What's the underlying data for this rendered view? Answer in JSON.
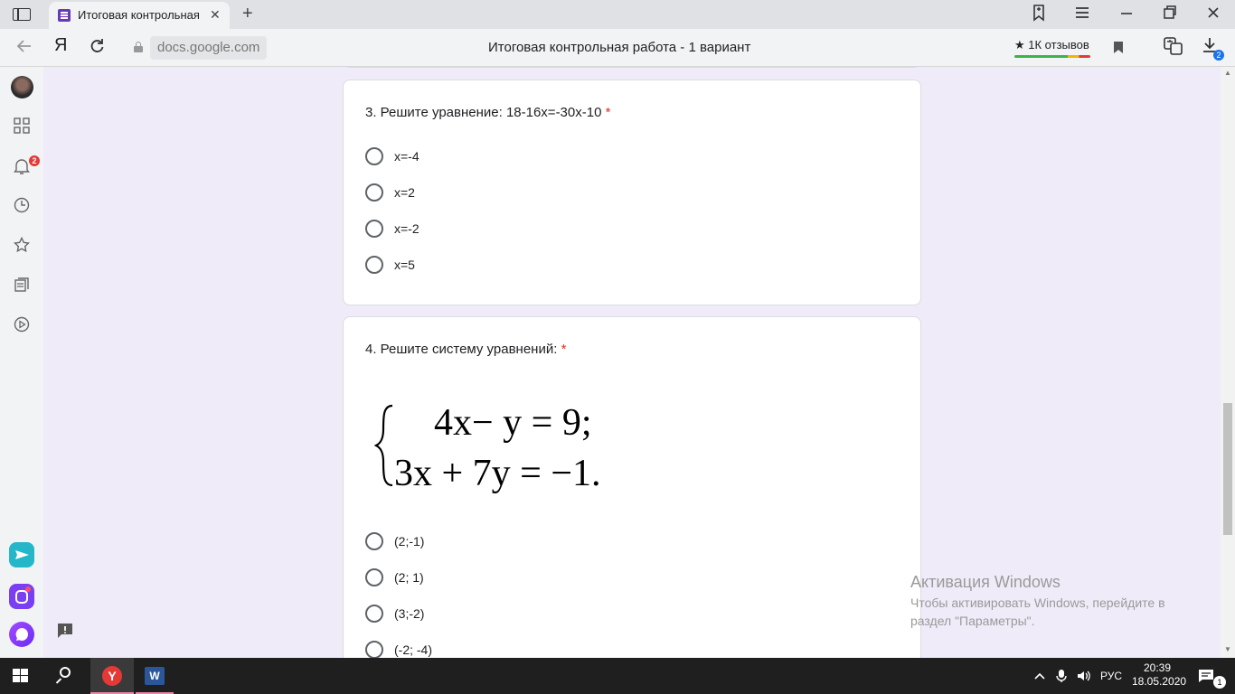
{
  "browser": {
    "tab_title": "Итоговая контрольная р",
    "domain": "docs.google.com",
    "page_title": "Итоговая контрольная работа - 1 вариант",
    "reviews": "★ 1К отзывов",
    "yandex_logo": "Я",
    "downloads_badge": "2"
  },
  "sidebar": {
    "notifications_badge": "2"
  },
  "form": {
    "q3": {
      "title": "3. Решите уравнение: 18-16x=-30x-10",
      "required_mark": "*",
      "options": [
        "x=-4",
        "x=2",
        "x=-2",
        "x=5"
      ]
    },
    "q4": {
      "title": "4. Решите систему уравнений:",
      "required_mark": "*",
      "equation_line1": "4x− y = 9;",
      "equation_line2": "3x + 7y = −1.",
      "options": [
        "(2;-1)",
        "(2; 1)",
        "(3;-2)",
        "(-2; -4)"
      ]
    }
  },
  "watermark": {
    "title": "Активация Windows",
    "text": "Чтобы активировать Windows, перейдите в раздел \"Параметры\"."
  },
  "taskbar": {
    "language": "РУС",
    "time": "20:39",
    "date": "18.05.2020",
    "yandex_letter": "Y",
    "word_letter": "W",
    "notifications_count": "1"
  }
}
